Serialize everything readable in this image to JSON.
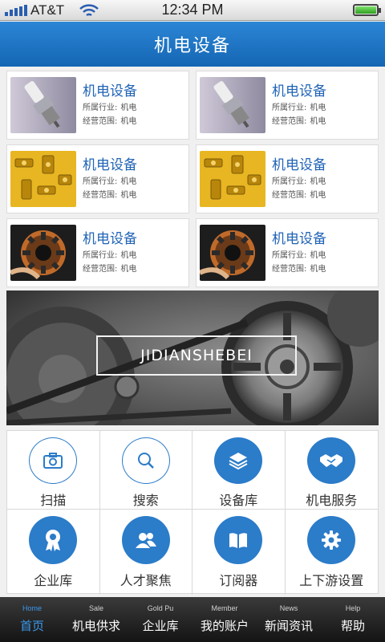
{
  "status_bar": {
    "carrier": "AT&T",
    "time": "12:34 PM",
    "battery_level": 1.0
  },
  "header": {
    "title": "机电设备"
  },
  "cards": [
    {
      "image": "spark-plug",
      "title": "机电设备",
      "industry_label": "所属行业:",
      "industry_value": "机电",
      "scope_label": "经营范围:",
      "scope_value": "机电"
    },
    {
      "image": "spark-plug",
      "title": "机电设备",
      "industry_label": "所属行业:",
      "industry_value": "机电",
      "scope_label": "经营范围:",
      "scope_value": "机电"
    },
    {
      "image": "brass-fittings",
      "title": "机电设备",
      "industry_label": "所属行业:",
      "industry_value": "机电",
      "scope_label": "经营范围:",
      "scope_value": "机电"
    },
    {
      "image": "brass-fittings",
      "title": "机电设备",
      "industry_label": "所属行业:",
      "industry_value": "机电",
      "scope_label": "经营范围:",
      "scope_value": "机电"
    },
    {
      "image": "motor-stator",
      "title": "机电设备",
      "industry_label": "所属行业:",
      "industry_value": "机电",
      "scope_label": "经营范围:",
      "scope_value": "机电"
    },
    {
      "image": "motor-stator",
      "title": "机电设备",
      "industry_label": "所属行业:",
      "industry_value": "机电",
      "scope_label": "经营范围:",
      "scope_value": "机电"
    }
  ],
  "banner": {
    "text": "JIDIANSHEBEI",
    "image": "engine-pulley-belt"
  },
  "menu": [
    {
      "label": "扫描",
      "icon": "camera-icon"
    },
    {
      "label": "搜索",
      "icon": "search-icon"
    },
    {
      "label": "设备库",
      "icon": "layers-icon"
    },
    {
      "label": "机电服务",
      "icon": "handshake-icon"
    },
    {
      "label": "企业库",
      "icon": "award-icon"
    },
    {
      "label": "人才聚焦",
      "icon": "people-icon"
    },
    {
      "label": "订阅器",
      "icon": "book-icon"
    },
    {
      "label": "上下游设置",
      "icon": "gear-icon"
    }
  ],
  "tabs": [
    {
      "en": "Home",
      "cn": "首页",
      "active": true
    },
    {
      "en": "Sale",
      "cn": "机电供求",
      "active": false
    },
    {
      "en": "Gold Pu",
      "cn": "企业库",
      "active": false
    },
    {
      "en": "Member",
      "cn": "我的账户",
      "active": false
    },
    {
      "en": "News",
      "cn": "新闻资讯",
      "active": false
    },
    {
      "en": "Help",
      "cn": "帮助",
      "active": false
    }
  ],
  "colors": {
    "primary": "#1f6fc0",
    "tab_active": "#3b9aee",
    "tabbar_bg": "#1c1c1c"
  }
}
